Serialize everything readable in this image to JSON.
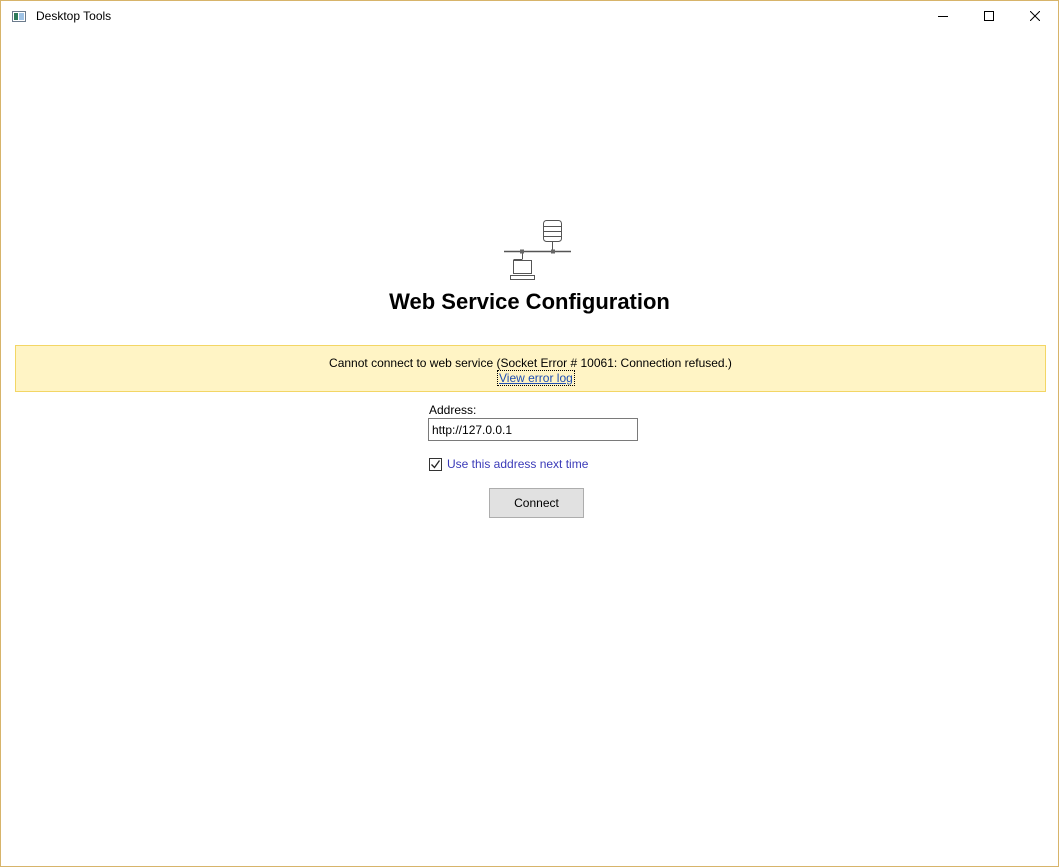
{
  "window": {
    "title": "Desktop Tools"
  },
  "page": {
    "title": "Web Service Configuration"
  },
  "error": {
    "message": "Cannot connect to web service (Socket Error # 10061: Connection refused.)",
    "link_label": "View error log"
  },
  "form": {
    "address_label": "Address:",
    "address_value": "http://127.0.0.1",
    "remember_label": "Use this address next time",
    "remember_checked": true,
    "connect_label": "Connect"
  },
  "icons": {
    "app": "app-window-icon",
    "hero": "network-server-icon",
    "minimize": "minimize-icon",
    "maximize": "maximize-icon",
    "close": "close-icon",
    "check": "checkmark-icon"
  },
  "colors": {
    "banner_background": "#fff4c5",
    "banner_border": "#f3d665",
    "link": "#1f4fb5",
    "checkbox_label": "#3a3ab8",
    "window_border": "#d7b46a",
    "button_background": "#e1e1e1"
  }
}
